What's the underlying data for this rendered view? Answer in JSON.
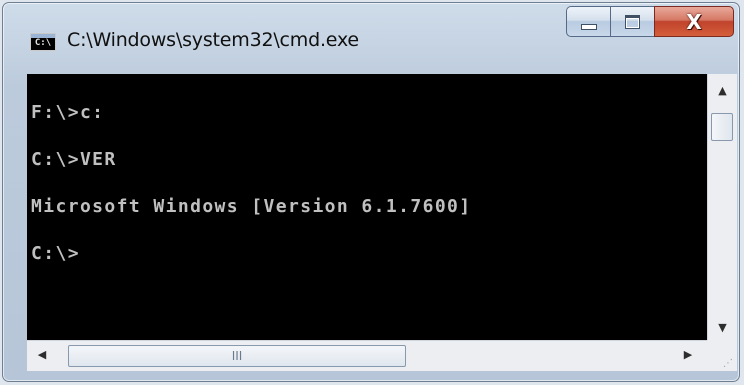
{
  "window": {
    "title": "C:\\Windows\\system32\\cmd.exe",
    "icon_label": "C:\\",
    "icon": "console-app-icon"
  },
  "caption_buttons": {
    "minimize": "minimize-icon",
    "maximize": "maximize-icon",
    "close": "close-icon",
    "close_glyph": "X"
  },
  "console": {
    "lines": [
      "F:\\>c:",
      "C:\\>VER",
      "Microsoft Windows [Version 6.1.7600]",
      "C:\\>"
    ],
    "background": "#000000",
    "foreground": "#c0c0c0"
  },
  "scrollbars": {
    "vertical": {
      "up": "scroll-up-arrow-icon",
      "down": "scroll-down-arrow-icon"
    },
    "horizontal": {
      "left": "scroll-left-arrow-icon",
      "right": "scroll-right-arrow-icon",
      "thumb_grip": "III"
    }
  },
  "colors": {
    "close_button": "#c9502f",
    "frame": "#b9c9da"
  }
}
